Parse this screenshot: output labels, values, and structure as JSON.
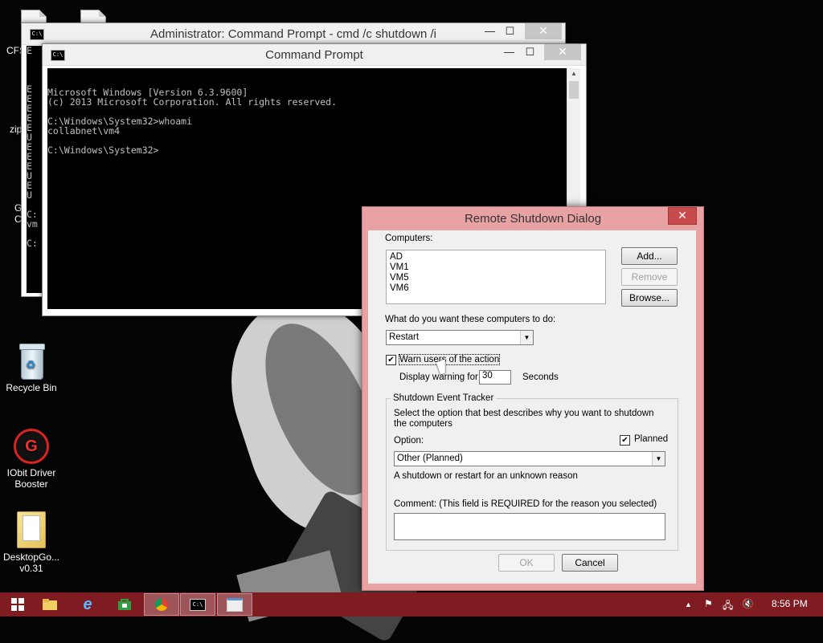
{
  "desktop": {
    "icons": [
      {
        "label": "CFS",
        "icon": "file-icon"
      },
      {
        "label": "zip",
        "icon": "file-icon"
      },
      {
        "label": "G C",
        "icon": "chrome-icon"
      },
      {
        "label": "Recycle Bin",
        "icon": "recycle-bin-icon"
      },
      {
        "label": "IObit Driver Booster",
        "icon": "iobit-driver-booster-icon"
      },
      {
        "label": "DesktopGo... v0.31",
        "icon": "folder-icon"
      }
    ]
  },
  "window_back": {
    "title": "Administrator:  Command Prompt - cmd  /c shutdown /i",
    "left_text": "E\n\n\n\nE\nE\nE\nE\nE\nU\nE\nE\nE\nU\nE\nU\n\nC:\nvm\n\nC:"
  },
  "window_front": {
    "title": "Command Prompt",
    "console_lines": [
      "Microsoft Windows [Version 6.3.9600]",
      "(c) 2013 Microsoft Corporation. All rights reserved.",
      "",
      "C:\\Windows\\System32>whoami",
      "collabnet\\vm4",
      "",
      "C:\\Windows\\System32>"
    ]
  },
  "dialog": {
    "title": "Remote Shutdown Dialog",
    "computers_label": "Computers:",
    "computers": [
      "AD",
      "VM1",
      "VM5",
      "VM6"
    ],
    "add_button": "Add...",
    "remove_button": "Remove",
    "browse_button": "Browse...",
    "action_label": "What do you want these computers to do:",
    "action_value": "Restart",
    "warn_checkbox_label": "Warn users of the action",
    "warn_checked": true,
    "display_warning_label": "Display warning for",
    "warning_seconds": "30",
    "seconds_label": "Seconds",
    "tracker_group_label": "Shutdown Event Tracker",
    "tracker_description": "Select the option that best describes why you want to shutdown the computers",
    "option_label": "Option:",
    "planned_label": "Planned",
    "planned_checked": true,
    "option_value": "Other (Planned)",
    "reason_text": "A shutdown or restart for an unknown reason",
    "comment_label": "Comment: (This field is REQUIRED for the reason you selected)",
    "comment_value": "",
    "ok_button": "OK",
    "cancel_button": "Cancel"
  },
  "taskbar": {
    "buttons": [
      {
        "name": "start-button",
        "icon": "windows-logo-icon"
      },
      {
        "name": "file-explorer-button",
        "icon": "folder-icon"
      },
      {
        "name": "internet-explorer-button",
        "icon": "ie-icon"
      },
      {
        "name": "store-button",
        "icon": "store-icon"
      },
      {
        "name": "chrome-button",
        "icon": "chrome-icon"
      },
      {
        "name": "command-prompt-button",
        "icon": "cmd-icon"
      },
      {
        "name": "remote-shutdown-button",
        "icon": "dialog-icon"
      }
    ],
    "clock": "8:56 PM"
  },
  "colors": {
    "taskbar": "#7e1c22",
    "dialog_frame": "#e8a2a4",
    "dialog_close": "#c74a4d"
  }
}
